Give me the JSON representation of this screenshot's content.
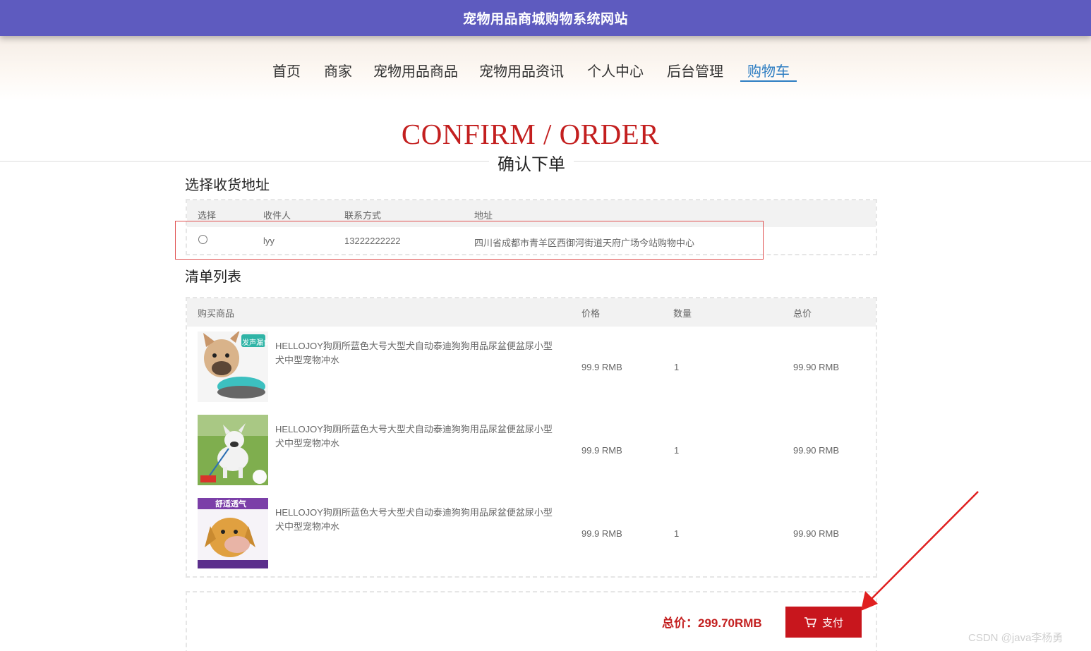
{
  "header": {
    "site_title": "宠物用品商城购物系统网站"
  },
  "nav": {
    "items": [
      {
        "label": "首页"
      },
      {
        "label": "商家"
      },
      {
        "label": "宠物用品商品"
      },
      {
        "label": "宠物用品资讯"
      },
      {
        "label": "个人中心"
      },
      {
        "label": "后台管理"
      },
      {
        "label": "购物车"
      }
    ],
    "active": "购物车"
  },
  "hero": {
    "title_en": "CONFIRM / ORDER",
    "title_cn": "确认下单"
  },
  "address_section": {
    "title": "选择收货地址",
    "columns": [
      "选择",
      "收件人",
      "联系方式",
      "地址"
    ],
    "rows": [
      {
        "recipient": "lyy",
        "phone": "13222222222",
        "address": "四川省成都市青羊区西御河街道天府广场今站购物中心"
      }
    ]
  },
  "list_section": {
    "title": "清单列表",
    "columns": [
      "购买商品",
      "价格",
      "数量",
      "总价"
    ],
    "rows": [
      {
        "name": "HELLOJOY狗厕所蓝色大号大型犬自动泰迪狗狗用品尿盆便盆尿小型犬中型宠物冲水",
        "price": "99.9 RMB",
        "qty": "1",
        "total": "99.90 RMB",
        "thumb_tag": "发声漏食"
      },
      {
        "name": "HELLOJOY狗厕所蓝色大号大型犬自动泰迪狗狗用品尿盆便盆尿小型犬中型宠物冲水",
        "price": "99.9 RMB",
        "qty": "1",
        "total": "99.90 RMB",
        "thumb_tag": ""
      },
      {
        "name": "HELLOJOY狗厕所蓝色大号大型犬自动泰迪狗狗用品尿盆便盆尿小型犬中型宠物冲水",
        "price": "99.9 RMB",
        "qty": "1",
        "total": "99.90 RMB",
        "thumb_tag": "舒适透气"
      }
    ]
  },
  "summary": {
    "total_label": "总价：299.70RMB",
    "pay_label": "支付"
  },
  "watermark": "CSDN @java李杨勇",
  "colors": {
    "topbar": "#5e5bbf",
    "accent_red": "#c31f1f",
    "nav_active": "#2d7dc2",
    "pay_button": "#c8161d"
  }
}
